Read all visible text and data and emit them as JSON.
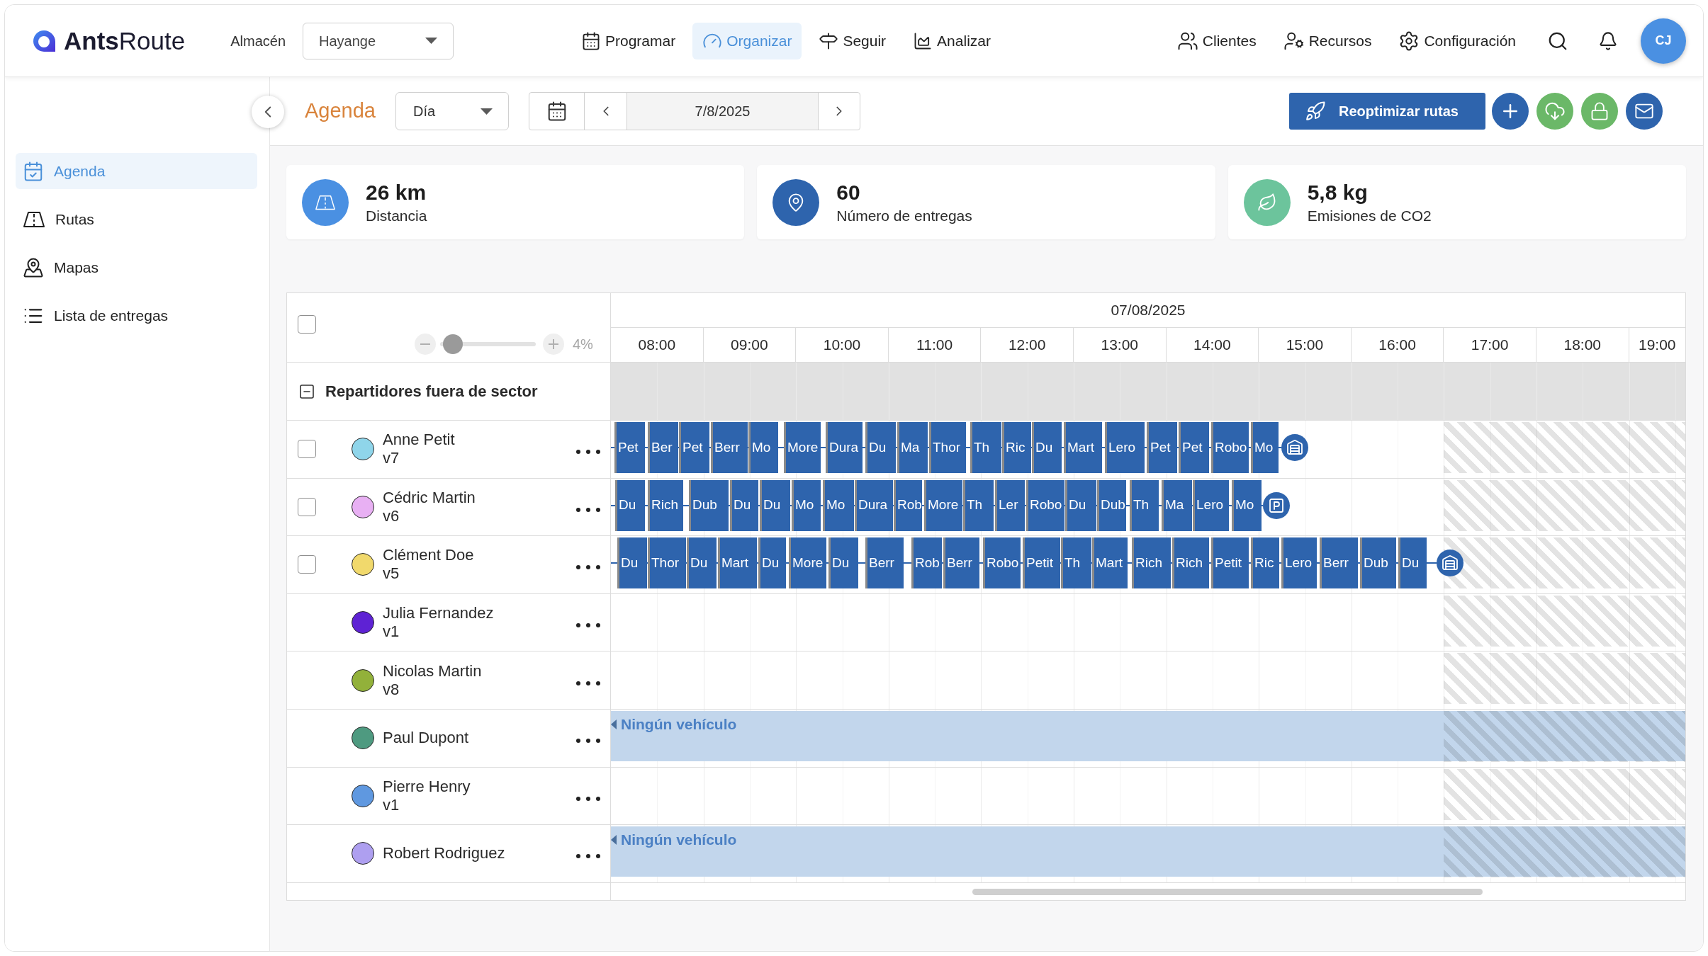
{
  "header": {
    "logo": "**Ants**Route",
    "warehouse": {
      "label": "Almacén",
      "value": "Hayange"
    },
    "nav": [
      {
        "label": "Programar",
        "selected": false
      },
      {
        "label": "Organizar",
        "selected": true
      },
      {
        "label": "Seguir",
        "selected": false
      },
      {
        "label": "Analizar",
        "selected": false
      }
    ],
    "links": [
      {
        "label": "Clientes"
      },
      {
        "label": "Recursos"
      },
      {
        "label": "Configuración"
      }
    ],
    "avatar": "CJ"
  },
  "sidebar": {
    "items": [
      {
        "label": "Agenda",
        "selected": true
      },
      {
        "label": "Rutas",
        "selected": false
      },
      {
        "label": "Mapas",
        "selected": false
      },
      {
        "label": "Lista de entregas",
        "selected": false
      }
    ]
  },
  "toolbar": {
    "title": "Agenda",
    "view": "Día",
    "date": "7/8/2025",
    "reoptimize": "Reoptimizar rutas"
  },
  "stats": [
    {
      "kind": "distance",
      "value": "26 km",
      "label": "Distancia"
    },
    {
      "kind": "deliveries",
      "value": "60",
      "label": "Número de entregas"
    },
    {
      "kind": "emissions",
      "value": "5,8 kg",
      "label": "Emisiones de CO2"
    }
  ],
  "schedule": {
    "select_all": {
      "checked": false
    },
    "zoom": {
      "level": 0.04,
      "reading": "4%"
    },
    "date": "07/08/2025",
    "hours": [
      "08:00",
      "09:00",
      "10:00",
      "11:00",
      "12:00",
      "13:00",
      "14:00",
      "15:00",
      "16:00",
      "17:00",
      "18:00",
      "19:00"
    ],
    "group": {
      "title": "Repartidores fuera de sector",
      "expanded": true
    },
    "drivers": [
      {
        "name": "Anne Petit",
        "vehicle": "v7",
        "color": "#8fd5ea",
        "checkbox": {
          "checked": false
        },
        "after_hours": true,
        "stops": [
          "Pet",
          "Ber",
          "Pet",
          "Berr",
          "Mo",
          "More",
          "Dura",
          "Du",
          "Ma",
          "Thor",
          "Th",
          "Ric",
          "Du",
          "Mart",
          "Lero",
          "Pet",
          "Pet",
          "Robo",
          "Mo"
        ],
        "end": {
          "kind": "depot"
        }
      },
      {
        "name": "Cédric Martin",
        "vehicle": "v6",
        "color": "#e8b0f3",
        "checkbox": {
          "checked": false
        },
        "after_hours": true,
        "stops": [
          "Du",
          "Rich",
          "Dub",
          "Du",
          "Du",
          "Mo",
          "Mo",
          "Dura",
          "Rob",
          "More",
          "Th",
          "Ler",
          "Robo",
          "Du",
          "Dub",
          "Th",
          "Ma",
          "Lero",
          "Mo"
        ],
        "end": {
          "kind": "parking"
        }
      },
      {
        "name": "Clément Doe",
        "vehicle": "v5",
        "color": "#f1d96c",
        "checkbox": {
          "checked": false
        },
        "after_hours": true,
        "stops": [
          "Du",
          "Thor",
          "Du",
          "Mart",
          "Du",
          "More",
          "Du",
          "Berr",
          "Rob",
          "Berr",
          "Robo",
          "Petit",
          "Th",
          "Mart",
          "Rich",
          "Rich",
          "Petit",
          "Ric",
          "Lero",
          "Berr",
          "Dub",
          "Du"
        ],
        "end": {
          "kind": "depot"
        }
      },
      {
        "name": "Julia Fernandez",
        "vehicle": "v1",
        "color": "#5e22d4",
        "after_hours": true
      },
      {
        "name": "Nicolas Martin",
        "vehicle": "v8",
        "color": "#92b13a",
        "after_hours": true
      },
      {
        "name": "Paul Dupont",
        "color": "#4e9a80",
        "after_hours": true,
        "notice": "Ningún vehículo"
      },
      {
        "name": "Pierre Henry",
        "vehicle": "v1",
        "color": "#5f98e0",
        "after_hours": true
      },
      {
        "name": "Robert Rodriguez",
        "color": "#ae9ff0",
        "after_hours": true,
        "notice": "Ningún vehículo"
      }
    ]
  }
}
